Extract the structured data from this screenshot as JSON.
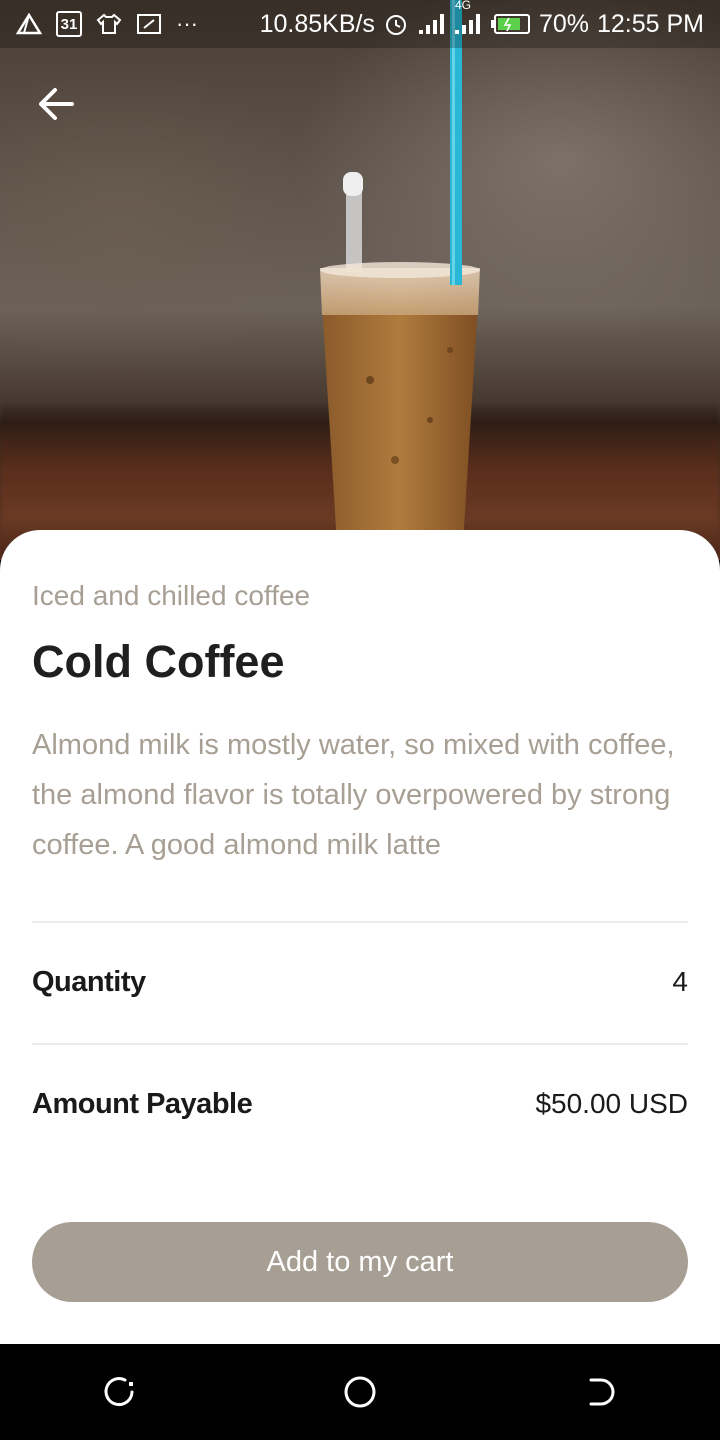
{
  "status_bar": {
    "calendar_day": "31",
    "overflow": "···",
    "net_speed": "10.85KB/s",
    "network_type": "4G",
    "battery": "70%",
    "time": "12:55 PM"
  },
  "product": {
    "category": "Iced and chilled coffee",
    "name": "Cold Coffee",
    "description": "Almond milk is mostly water, so mixed with coffee, the almond flavor is totally overpowered by strong coffee. A good almond milk latte",
    "image_icon": "iced-coffee-photo"
  },
  "details": {
    "quantity_label": "Quantity",
    "quantity_value": "4",
    "amount_label": "Amount Payable",
    "amount_value": "$50.00 USD"
  },
  "actions": {
    "add_to_cart": "Add to my cart"
  },
  "colors": {
    "accent": "#a79f94",
    "title": "#1f1f1f",
    "muted": "#a79f94"
  },
  "icons": {
    "back": "arrow-left-icon",
    "nav_recent": "recent-apps-icon",
    "nav_home": "home-circle-icon",
    "nav_back": "back-icon"
  }
}
